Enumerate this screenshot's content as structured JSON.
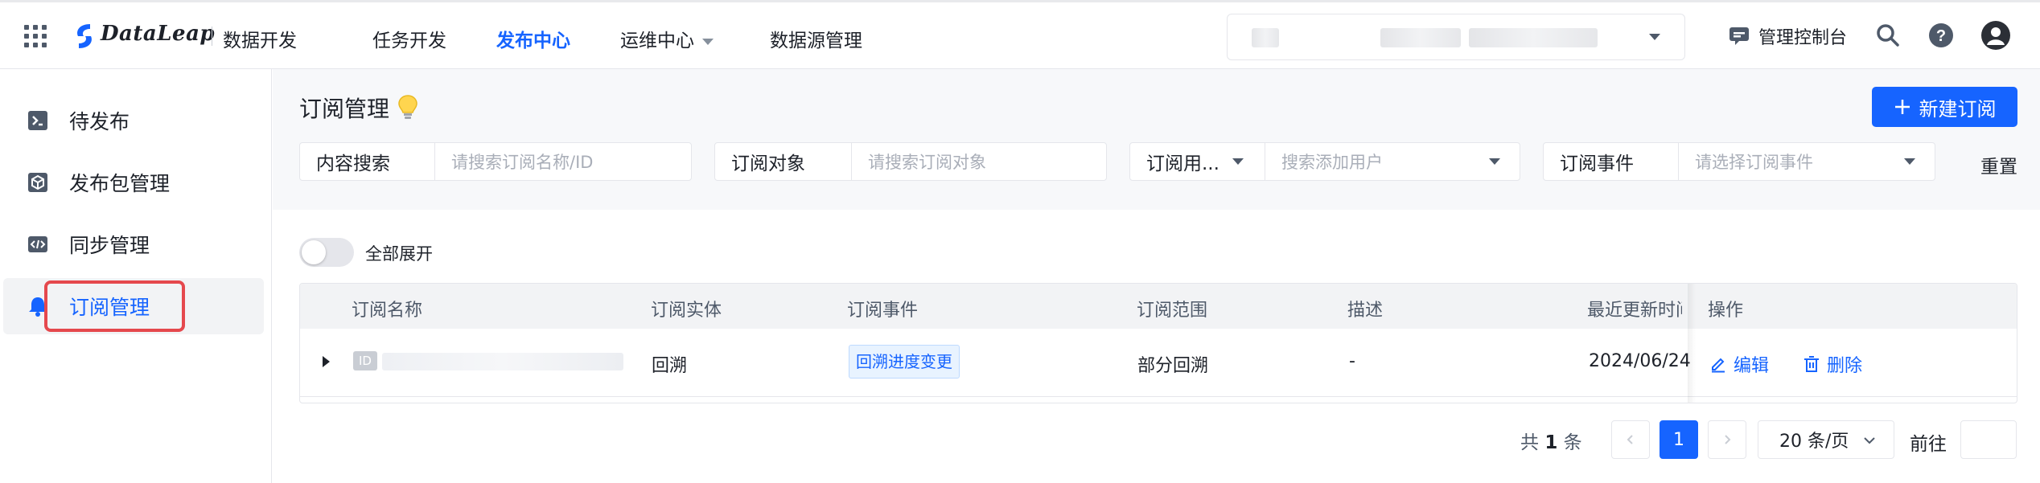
{
  "topbar": {
    "brand": "DataLeap",
    "product": "数据开发",
    "nav": [
      "任务开发",
      "发布中心",
      "运维中心",
      "数据源管理"
    ],
    "active_nav": "发布中心",
    "console": "管理控制台"
  },
  "sidebar": {
    "items": [
      {
        "label": "待发布",
        "icon": "terminal-icon"
      },
      {
        "label": "发布包管理",
        "icon": "package-icon"
      },
      {
        "label": "同步管理",
        "icon": "code-sync-icon"
      },
      {
        "label": "订阅管理",
        "icon": "bell-icon"
      }
    ],
    "active": "订阅管理"
  },
  "page": {
    "title": "订阅管理",
    "new_button": "新建订阅",
    "reset": "重置"
  },
  "filters": {
    "content_search": {
      "label": "内容搜索",
      "placeholder": "请搜索订阅名称/ID"
    },
    "subject": {
      "label": "订阅对象",
      "placeholder": "请搜索订阅对象"
    },
    "user": {
      "label": "订阅用...",
      "placeholder": "搜索添加用户"
    },
    "event": {
      "label": "订阅事件",
      "placeholder": "请选择订阅事件"
    }
  },
  "toggle": {
    "label": "全部展开",
    "on": false
  },
  "table": {
    "columns": [
      "订阅名称",
      "订阅实体",
      "订阅事件",
      "订阅范围",
      "描述",
      "最近更新时间",
      "操作"
    ],
    "rows": [
      {
        "id_badge": "ID",
        "entity": "回溯",
        "event": "回溯进度变更",
        "scope": "部分回溯",
        "desc": "-",
        "updated": "2024/06/24",
        "edit": "编辑",
        "delete": "删除"
      }
    ]
  },
  "pagination": {
    "total_prefix": "共",
    "total": "1",
    "total_suffix": "条",
    "current": "1",
    "page_size": "20 条/页",
    "goto": "前往"
  },
  "colors": {
    "accent": "#1664ff",
    "highlight": "#e5484d"
  }
}
